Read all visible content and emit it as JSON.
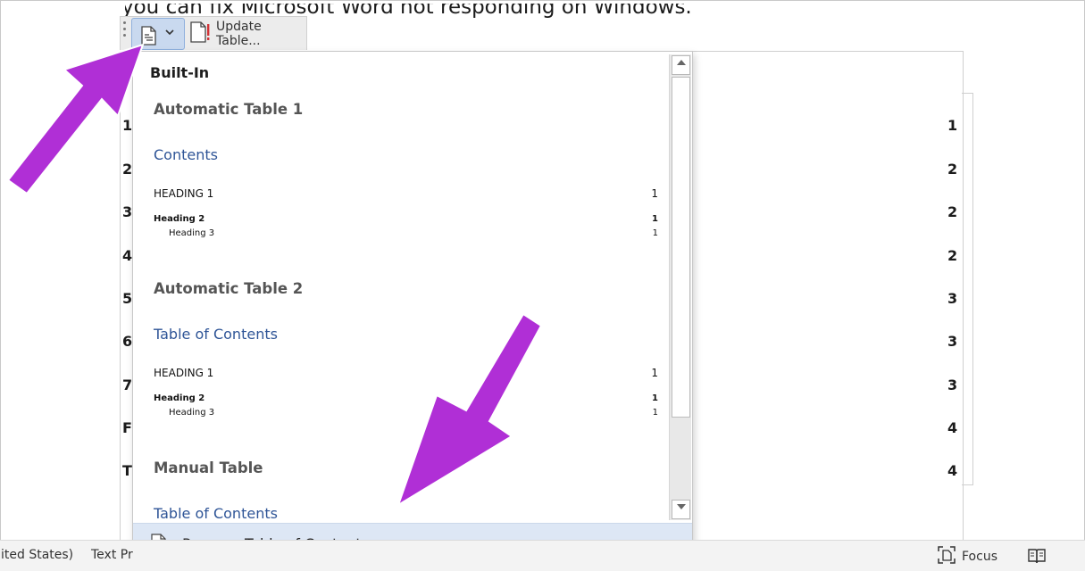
{
  "document": {
    "visible_text": "you can fix Microsoft Word not responding on Windows.",
    "left_numbers": [
      "1",
      "2",
      "3",
      "4",
      "5",
      "6",
      "7",
      "F",
      "T"
    ],
    "right_numbers": [
      "1",
      "2",
      "2",
      "2",
      "3",
      "3",
      "3",
      "4",
      "4"
    ]
  },
  "content_control": {
    "update_table_label": "Update Table..."
  },
  "gallery": {
    "section_header": "Built-In",
    "items": [
      {
        "title": "Automatic Table 1",
        "contents_label": "Contents",
        "heading1": "HEADING 1",
        "heading1_page": "1",
        "heading2": "Heading 2",
        "heading2_page": "1",
        "heading3": "Heading 3",
        "heading3_page": "1"
      },
      {
        "title": "Automatic Table 2",
        "contents_label": "Table of Contents",
        "heading1": "HEADING 1",
        "heading1_page": "1",
        "heading2": "Heading 2",
        "heading2_page": "1",
        "heading3": "Heading 3",
        "heading3_page": "1"
      },
      {
        "title": "Manual Table",
        "contents_label": "Table of Contents"
      }
    ],
    "remove_label_mnemonic": "R",
    "remove_label_rest": "emove Table of Contents"
  },
  "statusbar": {
    "language_text": "ited States)",
    "text_predictions": "Text Pr",
    "focus_label": "Focus"
  },
  "colors": {
    "accent_purple": "#b02fd6",
    "gallery_link_blue": "#2f5597",
    "remove_highlight": "#dde7f5"
  },
  "icons": {
    "toc": "document-toc-icon",
    "update": "update-table-icon",
    "remove": "remove-toc-icon",
    "focus": "focus-icon",
    "read_mode": "read-mode-icon"
  }
}
